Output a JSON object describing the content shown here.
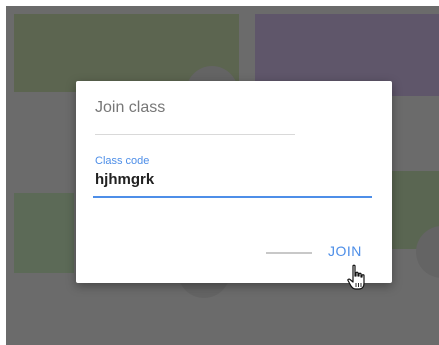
{
  "dialog": {
    "title": "Join class",
    "field_label": "Class code",
    "field_value": "hjhmgrk",
    "join_label": "JOIN"
  },
  "colors": {
    "accent": "#4d8ee8",
    "backdrop": "#6b6b6b"
  },
  "icons": {
    "cursor": "hand-pointer-icon"
  }
}
